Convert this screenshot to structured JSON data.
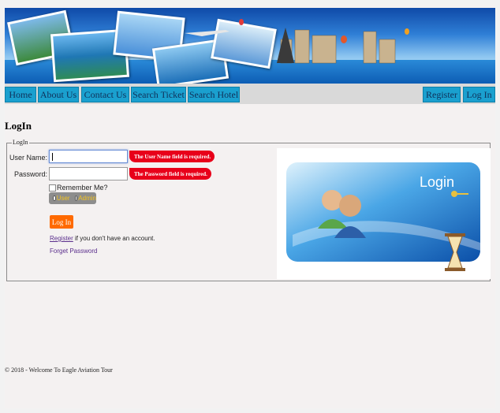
{
  "nav": {
    "left": [
      "Home",
      "About Us",
      "Contact Us",
      "Search Ticket",
      "Search Hotel"
    ],
    "right": [
      "Register",
      "Log In"
    ]
  },
  "page_title": "LogIn",
  "form": {
    "legend": "LogIn",
    "username_label": "User Name:",
    "username_value": "",
    "username_error": "The User Name field is required.",
    "password_label": "Password:",
    "password_value": "",
    "password_error": "The Password field is required.",
    "remember_label": "Remember Me?",
    "role_options": [
      "User",
      "Admin"
    ],
    "login_button": "Log In",
    "register_link": "Register",
    "register_suffix": " if you don't have an account.",
    "forget_link": "Forget Password"
  },
  "login_image": {
    "caption": "Login"
  },
  "footer": "© 2018 - Welcome To Eagle Aviation Tour",
  "colors": {
    "nav_button": "#1aa0cf",
    "error": "#e8001a",
    "login_button": "#ff6a00",
    "link": "#5a2e8c"
  }
}
